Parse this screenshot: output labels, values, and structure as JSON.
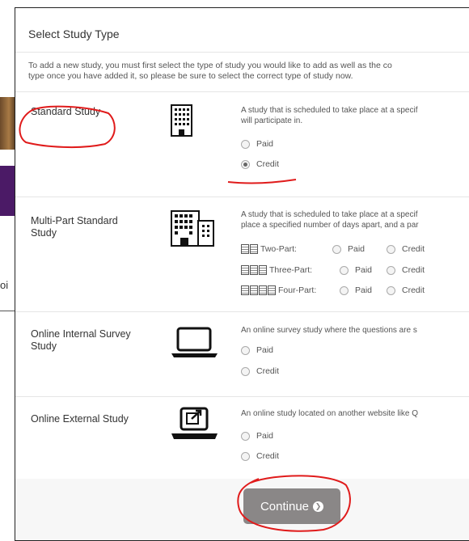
{
  "background": {
    "partial_text": "oi"
  },
  "modal": {
    "title": "Select Study Type",
    "intro_line1": "To add a new study, you must first select the type of study you would like to add as well as the co",
    "intro_line2": "type once you have added it, so please be sure to select the correct type of study now."
  },
  "study_types": [
    {
      "title": "Standard Study",
      "icon": "building-icon",
      "desc_line1": "A study that is scheduled to take place at a specif",
      "desc_line2": "will participate in.",
      "options": [
        {
          "label": "Paid",
          "selected": false
        },
        {
          "label": "Credit",
          "selected": true
        }
      ]
    },
    {
      "title": "Multi-Part Standard Study",
      "icon": "multi-building-icon",
      "desc_line1": "A study that is scheduled to take place at a specif",
      "desc_line2": "place a specified number of days apart, and a par",
      "parts": [
        {
          "label": "Two-Part:",
          "paid": "Paid",
          "credit": "Credit"
        },
        {
          "label": "Three-Part:",
          "paid": "Paid",
          "credit": "Credit"
        },
        {
          "label": "Four-Part:",
          "paid": "Paid",
          "credit": "Credit"
        }
      ]
    },
    {
      "title": "Online Internal Survey Study",
      "icon": "laptop-icon",
      "desc_line1": "An online survey study where the questions are s",
      "options": [
        {
          "label": "Paid",
          "selected": false
        },
        {
          "label": "Credit",
          "selected": false
        }
      ]
    },
    {
      "title": "Online External Study",
      "icon": "laptop-external-link-icon",
      "desc_line1": "An online study located on another website like Q",
      "options": [
        {
          "label": "Paid",
          "selected": false
        },
        {
          "label": "Credit",
          "selected": false
        }
      ]
    }
  ],
  "footer": {
    "continue_label": "Continue"
  },
  "annotation_color": "#e01b1b"
}
